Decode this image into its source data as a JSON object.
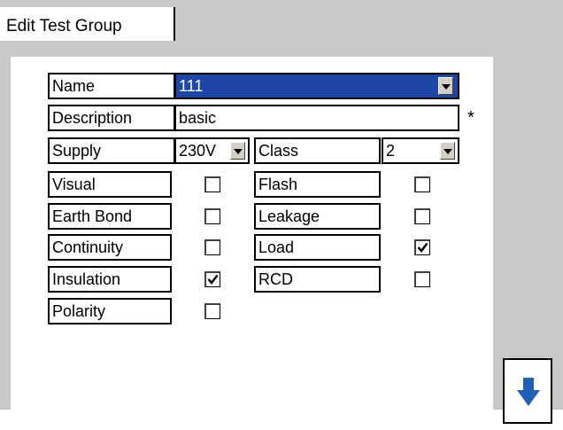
{
  "tab": {
    "label": "Edit Test Group"
  },
  "form": {
    "name": {
      "label": "Name",
      "value": "111"
    },
    "description": {
      "label": "Description",
      "value": "basic",
      "required_marker": "*"
    },
    "supply": {
      "label": "Supply",
      "value": "230V"
    },
    "class": {
      "label": "Class",
      "value": "2"
    },
    "tests_left": [
      {
        "label": "Visual",
        "checked": false
      },
      {
        "label": "Earth Bond",
        "checked": false
      },
      {
        "label": "Continuity",
        "checked": false
      },
      {
        "label": "Insulation",
        "checked": true
      },
      {
        "label": "Polarity",
        "checked": false
      }
    ],
    "tests_right": [
      {
        "label": "Flash",
        "checked": false
      },
      {
        "label": "Leakage",
        "checked": false
      },
      {
        "label": "Load",
        "checked": true
      },
      {
        "label": "RCD",
        "checked": false
      }
    ]
  },
  "scroll_button": {
    "icon": "arrow-down-icon"
  },
  "colors": {
    "selection": "#1f46a6",
    "arrow": "#1f5fb4",
    "background": "#c8c8c8"
  }
}
